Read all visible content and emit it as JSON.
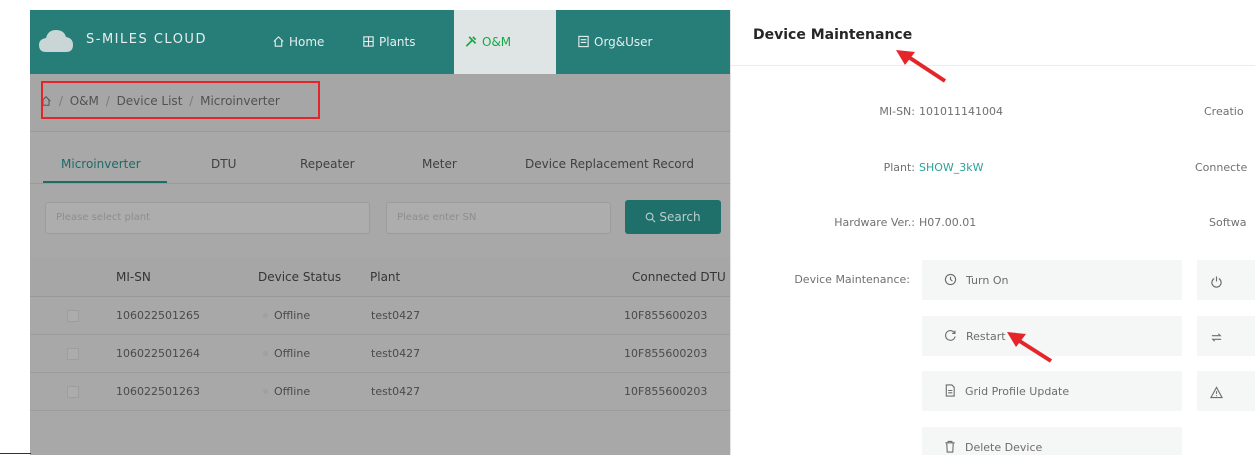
{
  "app": {
    "brand": "S-MILES CLOUD",
    "nav": [
      {
        "label": "Home",
        "icon": "home-icon",
        "active": false
      },
      {
        "label": "Plants",
        "icon": "plants-icon",
        "active": false
      },
      {
        "label": "O&M",
        "icon": "tools-icon",
        "active": true
      },
      {
        "label": "Org&User",
        "icon": "org-icon",
        "active": false
      }
    ],
    "breadcrumb": [
      "O&M",
      "Device List",
      "Microinverter"
    ],
    "tabs": [
      "Microinverter",
      "DTU",
      "Repeater",
      "Meter",
      "Device Replacement Record"
    ],
    "active_tab": "Microinverter",
    "filters": {
      "plant_placeholder": "Please select plant",
      "sn_placeholder": "Please enter SN",
      "search_label": "Search"
    },
    "table": {
      "headers": [
        "MI-SN",
        "Device Status",
        "Plant",
        "Connected DTU"
      ],
      "rows": [
        {
          "sn": "106022501265",
          "status": "Offline",
          "plant": "test0427",
          "dtu": "10F855600203"
        },
        {
          "sn": "106022501264",
          "status": "Offline",
          "plant": "test0427",
          "dtu": "10F855600203"
        },
        {
          "sn": "106022501263",
          "status": "Offline",
          "plant": "test0427",
          "dtu": "10F855600203"
        }
      ]
    }
  },
  "drawer": {
    "title": "Device Maintenance",
    "fields": [
      {
        "label": "MI-SN:",
        "value": "101011141004",
        "link": false
      },
      {
        "label": "Plant:",
        "value": "SHOW_3kW",
        "link": true
      },
      {
        "label": "Hardware Ver.:",
        "value": "H07.00.01",
        "link": false
      }
    ],
    "right_labels": [
      "Creatio",
      "Connecte",
      "Softwa"
    ],
    "maintenance_label": "Device Maintenance:",
    "actions": [
      {
        "label": "Turn On",
        "icon": "clock-icon"
      },
      {
        "label": "Restart",
        "icon": "restart-icon"
      },
      {
        "label": "Grid Profile Update",
        "icon": "file-icon"
      },
      {
        "label": "Delete Device",
        "icon": "trash-icon"
      }
    ],
    "right_actions": [
      "power-icon",
      "swap-icon",
      "warning-icon"
    ]
  },
  "colors": {
    "nav_bg": "#277d78",
    "accent": "#2aa198",
    "highlight_box": "#e5252a",
    "arrow": "#e5252a"
  }
}
